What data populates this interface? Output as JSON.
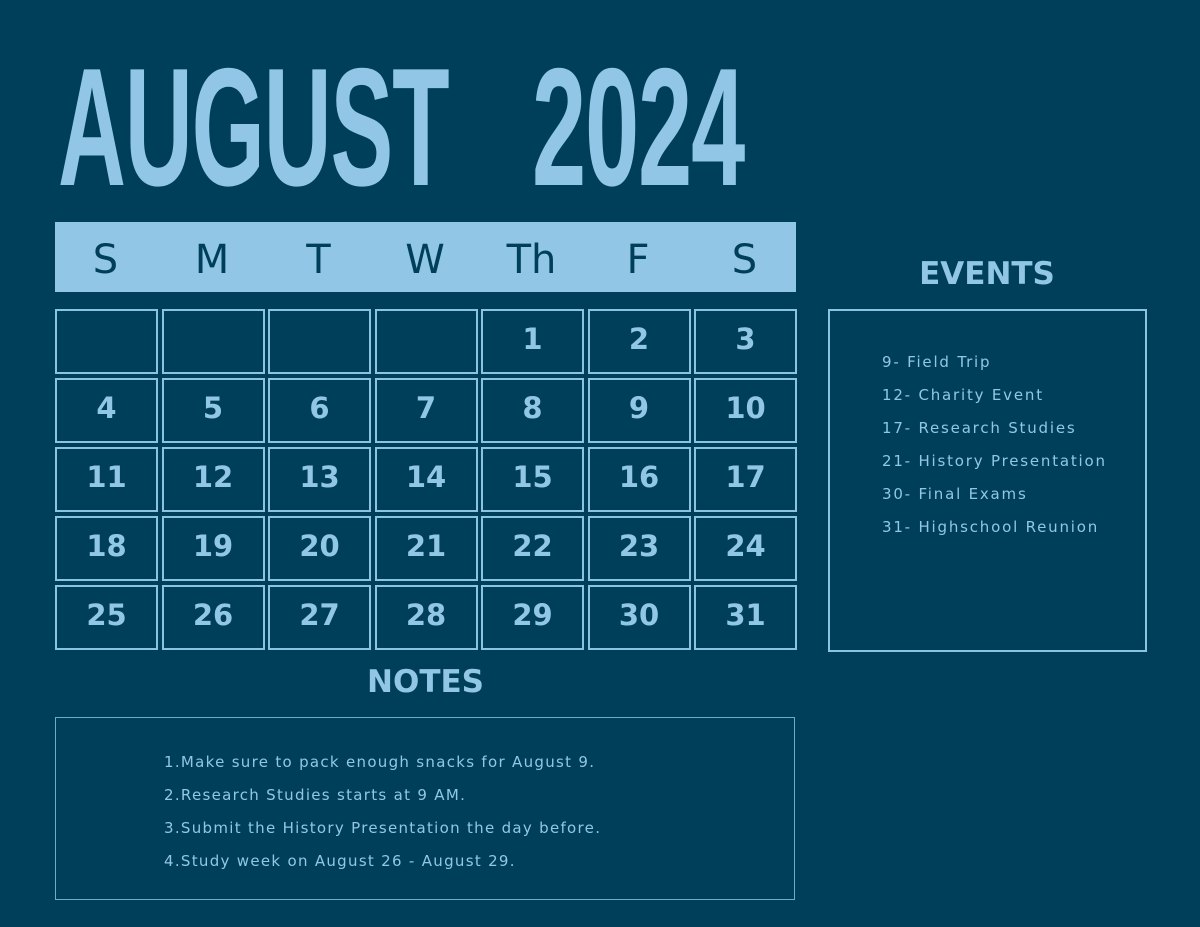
{
  "header": {
    "month": "AUGUST",
    "year": "2024"
  },
  "calendar": {
    "weekdays": [
      "S",
      "M",
      "T",
      "W",
      "Th",
      "F",
      "S"
    ],
    "weeks": [
      [
        "",
        "",
        "",
        "",
        "1",
        "2",
        "3"
      ],
      [
        "4",
        "5",
        "6",
        "7",
        "8",
        "9",
        "10"
      ],
      [
        "11",
        "12",
        "13",
        "14",
        "15",
        "16",
        "17"
      ],
      [
        "18",
        "19",
        "20",
        "21",
        "22",
        "23",
        "24"
      ],
      [
        "25",
        "26",
        "27",
        "28",
        "29",
        "30",
        "31"
      ]
    ]
  },
  "events": {
    "title": "EVENTS",
    "items": [
      "9- Field Trip",
      "12- Charity Event",
      "17- Research Studies",
      "21- History Presentation",
      "30- Final Exams",
      "31- Highschool Reunion"
    ]
  },
  "notes": {
    "title": "NOTES",
    "items": [
      "1.Make sure to pack enough snacks for August 9.",
      "2.Research Studies starts at 9 AM.",
      "3.Submit the History Presentation the day before.",
      "4.Study week on August 26 - August 29."
    ]
  },
  "colors": {
    "background": "#003f5a",
    "accent": "#92c6e6"
  }
}
